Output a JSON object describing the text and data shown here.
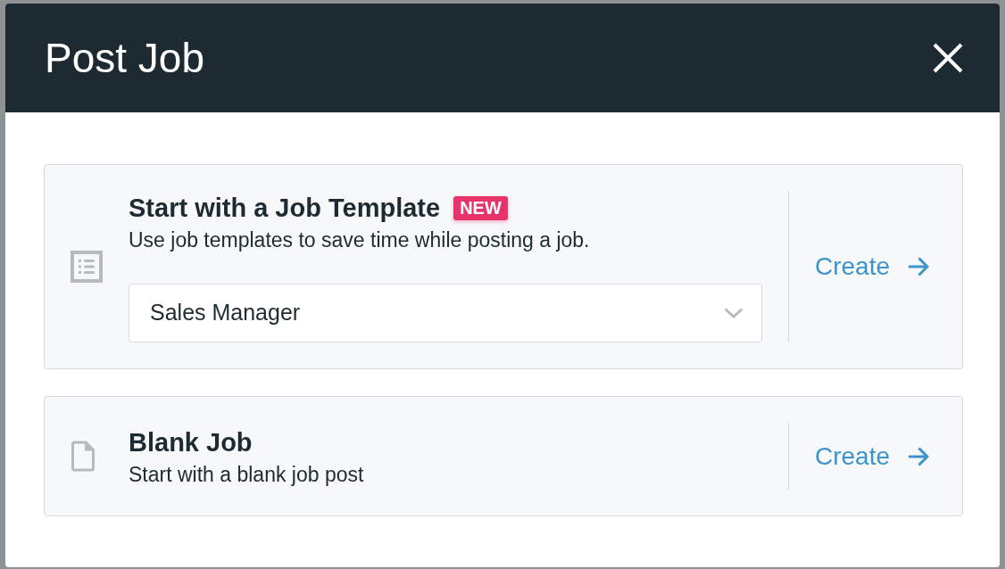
{
  "dialog": {
    "title": "Post Job"
  },
  "options": [
    {
      "kind": "template",
      "title": "Start with a Job Template",
      "badge": "NEW",
      "description": "Use job templates to save time while posting a job.",
      "select": {
        "value": "Sales Manager"
      },
      "action": "Create"
    },
    {
      "kind": "blank",
      "title": "Blank Job",
      "description": "Start with a blank job post",
      "action": "Create"
    }
  ]
}
